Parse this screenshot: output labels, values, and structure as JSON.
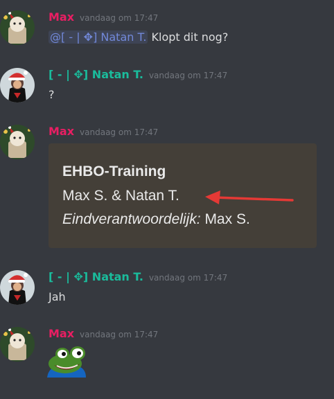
{
  "messages": [
    {
      "author": "Max",
      "timestamp": "vandaag om 17:47",
      "mention": "@[ - | ✥] Natan T.",
      "text": "Klopt dit nog?"
    },
    {
      "author": "[ - | ✥] Natan T.",
      "timestamp": "vandaag om 17:47",
      "text": "?"
    },
    {
      "author": "Max",
      "timestamp": "vandaag om 17:47",
      "embed": {
        "title": "EHBO-Training",
        "names": "Max S. & Natan T.",
        "responsible_label": "Eindverantwoordelijk:",
        "responsible_value": " Max S."
      }
    },
    {
      "author": "[ - | ✥] Natan T.",
      "timestamp": "vandaag om 17:47",
      "text": "Jah"
    },
    {
      "author": "Max",
      "timestamp": "vandaag om 17:47",
      "sticker": "pepe-frog-emoji-icon"
    }
  ],
  "colors": {
    "background": "#36393f",
    "max_name": "#e91e63",
    "natan_name": "#1abc9c",
    "timestamp": "#72767d",
    "mention": "#7289da",
    "embed_bg": "#443f38",
    "arrow": "#e53935"
  }
}
